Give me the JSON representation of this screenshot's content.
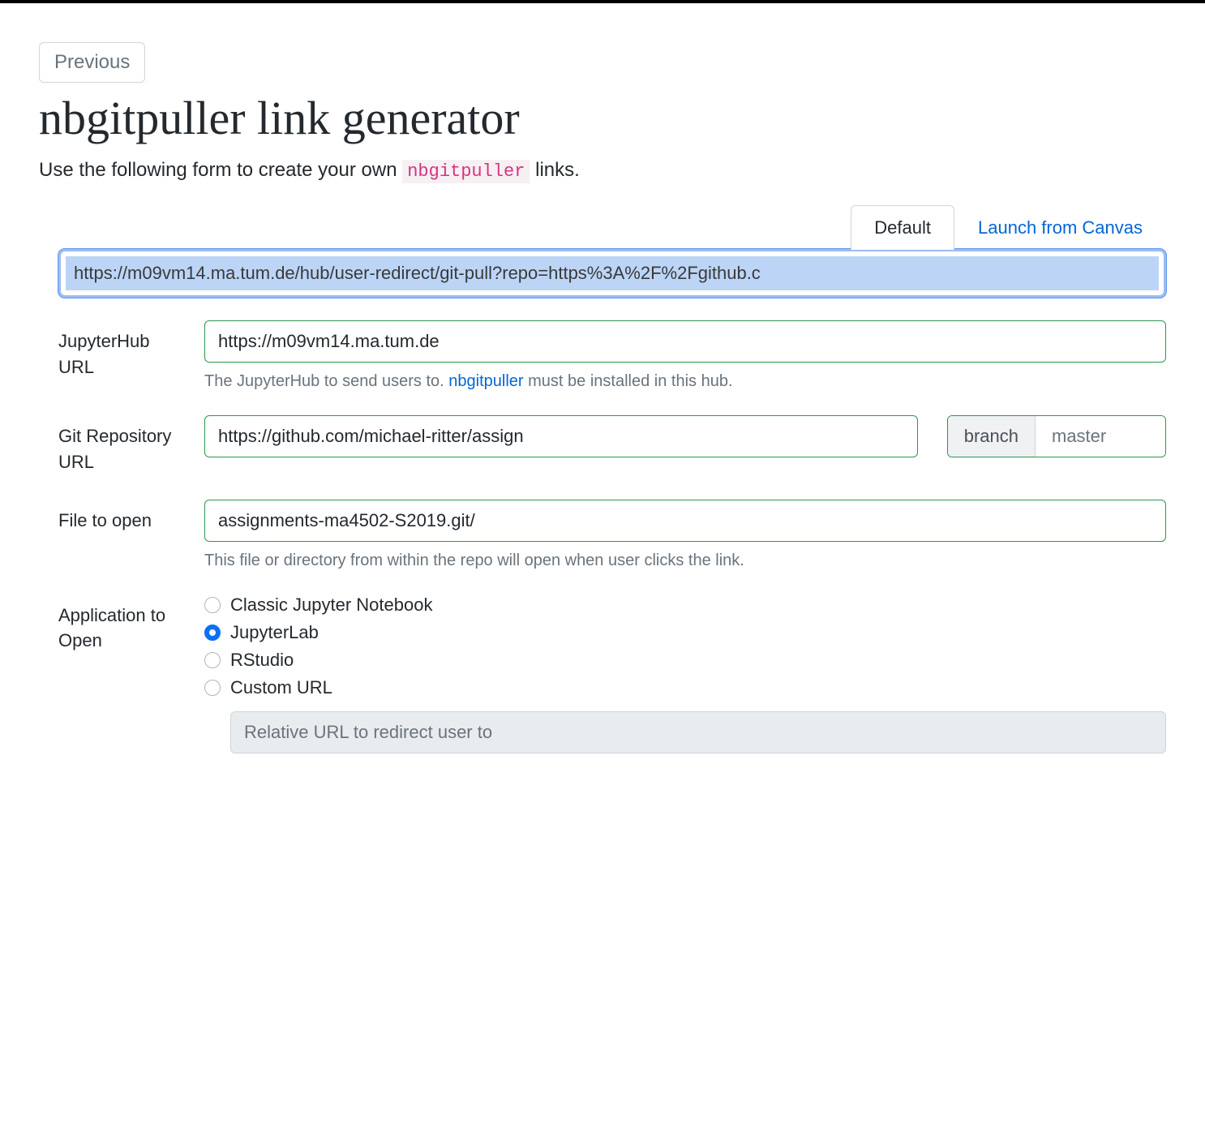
{
  "nav": {
    "previous_label": "Previous"
  },
  "header": {
    "title": "nbgitpuller link generator",
    "subtitle_prefix": "Use the following form to create your own ",
    "subtitle_code": "nbgitpuller",
    "subtitle_suffix": " links."
  },
  "tabs": {
    "default": "Default",
    "canvas": "Launch from Canvas"
  },
  "generated_url": "https://m09vm14.ma.tum.de/hub/user-redirect/git-pull?repo=https%3A%2F%2Fgithub.c",
  "form": {
    "hub": {
      "label": "JupyterHub URL",
      "value": "https://m09vm14.ma.tum.de",
      "helper_prefix": "The JupyterHub to send users to. ",
      "helper_link": "nbgitpuller",
      "helper_suffix": " must be installed in this hub."
    },
    "repo": {
      "label": "Git Repository URL",
      "value": "https://github.com/michael-ritter/assign",
      "branch_label": "branch",
      "branch_value": "master"
    },
    "file": {
      "label": "File to open",
      "value": "assignments-ma4502-S2019.git/",
      "helper": "This file or directory from within the repo will open when user clicks the link."
    },
    "app": {
      "label": "Application to Open",
      "options": {
        "classic": "Classic Jupyter Notebook",
        "jupyterlab": "JupyterLab",
        "rstudio": "RStudio",
        "custom": "Custom URL"
      },
      "selected": "jupyterlab",
      "custom_placeholder": "Relative URL to redirect user to"
    }
  }
}
